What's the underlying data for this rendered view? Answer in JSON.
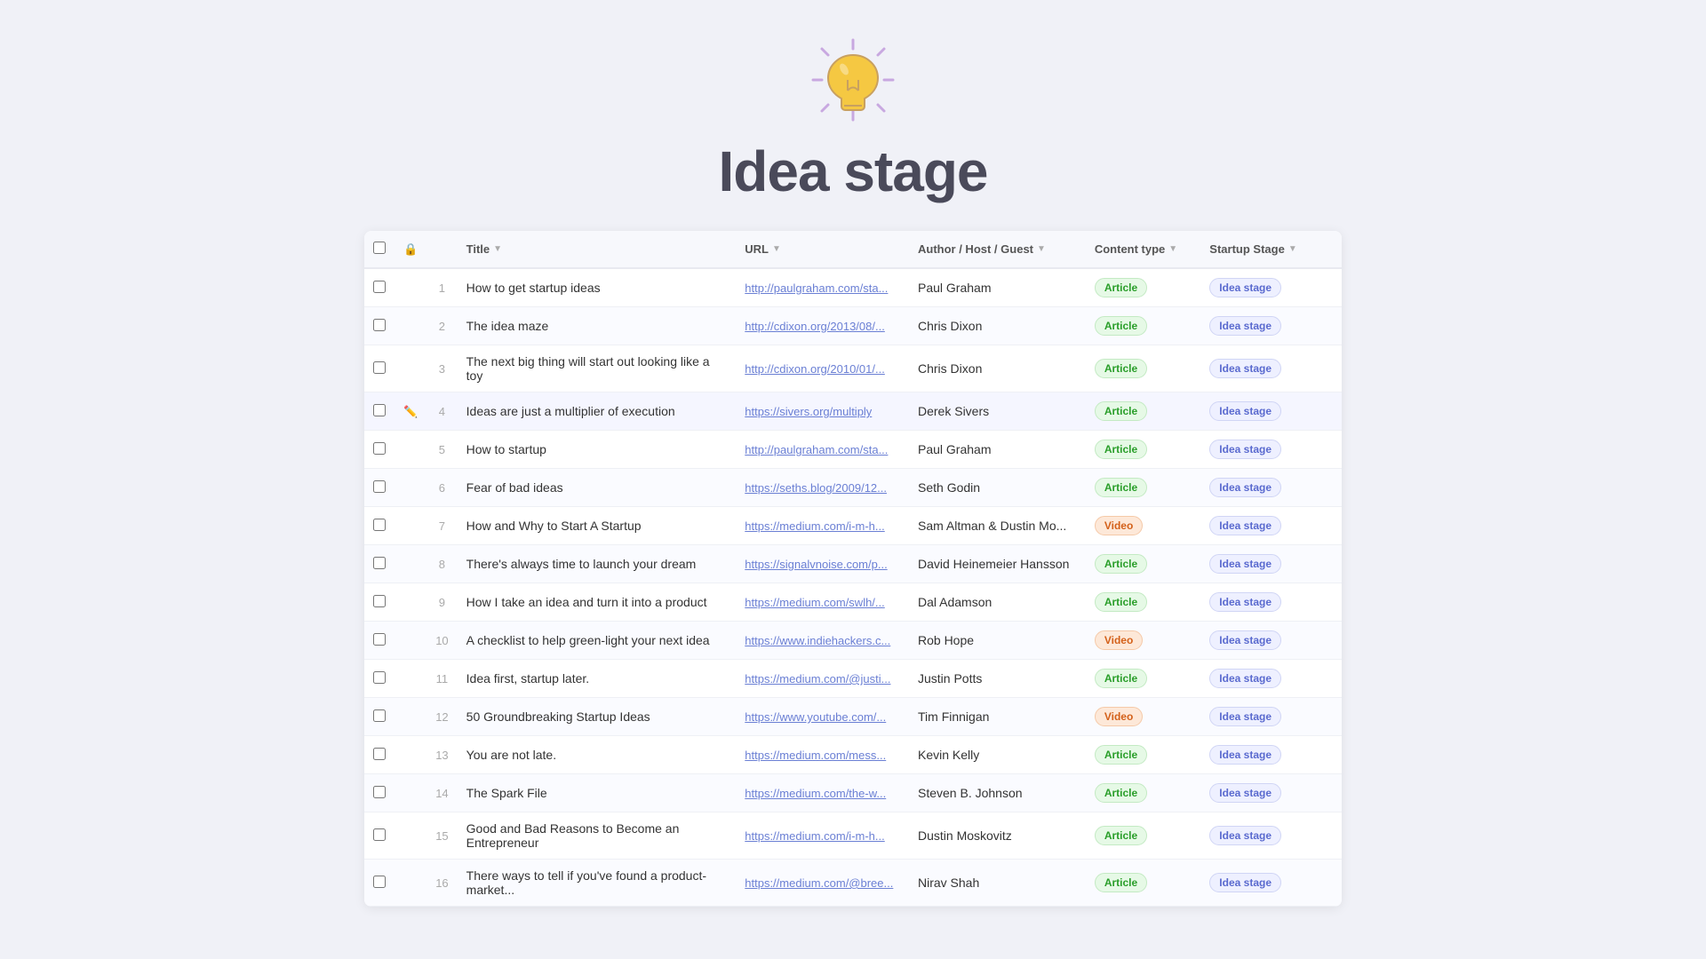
{
  "page": {
    "title": "Idea stage"
  },
  "table": {
    "columns": [
      {
        "key": "check",
        "label": ""
      },
      {
        "key": "lock",
        "label": ""
      },
      {
        "key": "num",
        "label": ""
      },
      {
        "key": "title",
        "label": "Title"
      },
      {
        "key": "url",
        "label": "URL"
      },
      {
        "key": "author",
        "label": "Author / Host / Guest"
      },
      {
        "key": "type",
        "label": "Content type"
      },
      {
        "key": "stage",
        "label": "Startup Stage"
      }
    ],
    "rows": [
      {
        "num": "1",
        "title": "How to get startup ideas",
        "url": "http://paulgraham.com/sta...",
        "url_full": "http://paulgraham.com/sta",
        "author": "Paul Graham",
        "type": "Article",
        "stage": "Idea stage"
      },
      {
        "num": "2",
        "title": "The idea maze",
        "url": "http://cdixon.org/2013/08/...",
        "url_full": "http://cdixon.org/2013/08/",
        "author": "Chris Dixon",
        "type": "Article",
        "stage": "Idea stage"
      },
      {
        "num": "3",
        "title": "The next big thing will start out looking like a toy",
        "url": "http://cdixon.org/2010/01/...",
        "url_full": "http://cdixon.org/2010/01/",
        "author": "Chris Dixon",
        "type": "Article",
        "stage": "Idea stage"
      },
      {
        "num": "4",
        "title": "Ideas are just a multiplier of execution",
        "url": "https://sivers.org/multiply",
        "url_full": "https://sivers.org/multiply",
        "author": "Derek Sivers",
        "type": "Article",
        "stage": "Idea stage"
      },
      {
        "num": "5",
        "title": "How to startup",
        "url": "http://paulgraham.com/sta...",
        "url_full": "http://paulgraham.com/sta",
        "author": "Paul Graham",
        "type": "Article",
        "stage": "Idea stage"
      },
      {
        "num": "6",
        "title": "Fear of bad ideas",
        "url": "https://seths.blog/2009/12...",
        "url_full": "https://seths.blog/2009/12",
        "author": "Seth Godin",
        "type": "Article",
        "stage": "Idea stage"
      },
      {
        "num": "7",
        "title": "How and Why to Start A Startup",
        "url": "https://medium.com/i-m-h...",
        "url_full": "https://medium.com/i-m-h",
        "author": "Sam Altman & Dustin Mo...",
        "type": "Video",
        "stage": "Idea stage"
      },
      {
        "num": "8",
        "title": "There's always time to launch your dream",
        "url": "https://signalvnoise.com/p...",
        "url_full": "https://signalvnoise.com/p",
        "author": "David Heinemeier Hansson",
        "type": "Article",
        "stage": "Idea stage"
      },
      {
        "num": "9",
        "title": "How I take an idea and turn it into a product",
        "url": "https://medium.com/swlh/...",
        "url_full": "https://medium.com/swlh/",
        "author": "Dal Adamson",
        "type": "Article",
        "stage": "Idea stage"
      },
      {
        "num": "10",
        "title": "A checklist to help green-light your next idea",
        "url": "https://www.indiehackers.c...",
        "url_full": "https://www.indiehackers.c",
        "author": "Rob Hope",
        "type": "Video",
        "stage": "Idea stage"
      },
      {
        "num": "11",
        "title": "Idea first, startup later.",
        "url": "https://medium.com/@justi...",
        "url_full": "https://medium.com/@justi",
        "author": "Justin Potts",
        "type": "Article",
        "stage": "Idea stage"
      },
      {
        "num": "12",
        "title": "50 Groundbreaking Startup Ideas",
        "url": "https://www.youtube.com/...",
        "url_full": "https://www.youtube.com/",
        "author": "Tim Finnigan",
        "type": "Video",
        "stage": "Idea stage"
      },
      {
        "num": "13",
        "title": "You are not late.",
        "url": "https://medium.com/mess...",
        "url_full": "https://medium.com/mess",
        "author": "Kevin Kelly",
        "type": "Article",
        "stage": "Idea stage"
      },
      {
        "num": "14",
        "title": "The Spark File",
        "url": "https://medium.com/the-w...",
        "url_full": "https://medium.com/the-w",
        "author": "Steven B. Johnson",
        "type": "Article",
        "stage": "Idea stage"
      },
      {
        "num": "15",
        "title": "Good and Bad Reasons to Become an Entrepreneur",
        "url": "https://medium.com/i-m-h...",
        "url_full": "https://medium.com/i-m-h",
        "author": "Dustin Moskovitz",
        "type": "Article",
        "stage": "Idea stage"
      },
      {
        "num": "16",
        "title": "There ways to tell if you've found a product-market...",
        "url": "https://medium.com/@bree...",
        "url_full": "https://medium.com/@bree",
        "author": "Nirav Shah",
        "type": "Article",
        "stage": "Idea stage"
      }
    ]
  }
}
